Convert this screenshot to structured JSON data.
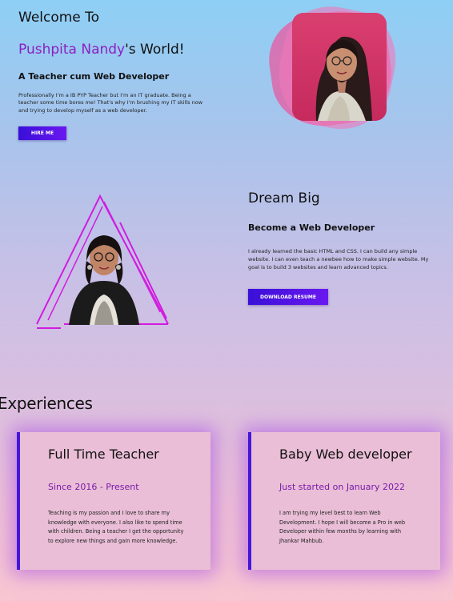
{
  "hero": {
    "welcome": "Welcome To",
    "name_highlight": "Pushpita Nandy",
    "name_rest": "'s World!",
    "subtitle": "A Teacher cum Web Developer",
    "description": "Professionally I'm a IB PYP Teacher but I'm an IT graduate. Being a teacher some time bores me! That's why I'm brushing my IT skills now and trying to develop myself as a web developer.",
    "hire_button": "HIRE ME"
  },
  "about": {
    "title": "Dream Big",
    "subtitle": "Become a Web Developer",
    "description": "I already learned the basic HTML and CSS. I can build any simple website. I can even teach a newbee how to make simple website. My goal is to build 3 websites and learn advanced topics.",
    "download_button": "DOWNLOAD RESUME"
  },
  "experiences": {
    "heading": "Experiences",
    "cards": [
      {
        "title": "Full Time Teacher",
        "date": "Since 2016 - Present",
        "text": "Teaching is my passion and I love to share my knowledge with everyone. I also like to spend time with children. Being a teacher I get the opportunity to explore new things and gain more knowledge."
      },
      {
        "title": "Baby Web developer",
        "date": "Just started on January 2022",
        "text": "I am trying my level best to learn Web Development. I hope I will become a Pro in web Developer within few months by learning with Jhankar Mahbub."
      }
    ]
  },
  "colors": {
    "accent_purple": "#8b1fc0",
    "button_blue": "#3a0fd8",
    "triangle_magenta": "#d21ce0",
    "photo_backdrop_pink": "#e85aa0"
  },
  "icons": {
    "profile_photo": "person-portrait-icon",
    "triangle_photo": "person-portrait-icon"
  }
}
